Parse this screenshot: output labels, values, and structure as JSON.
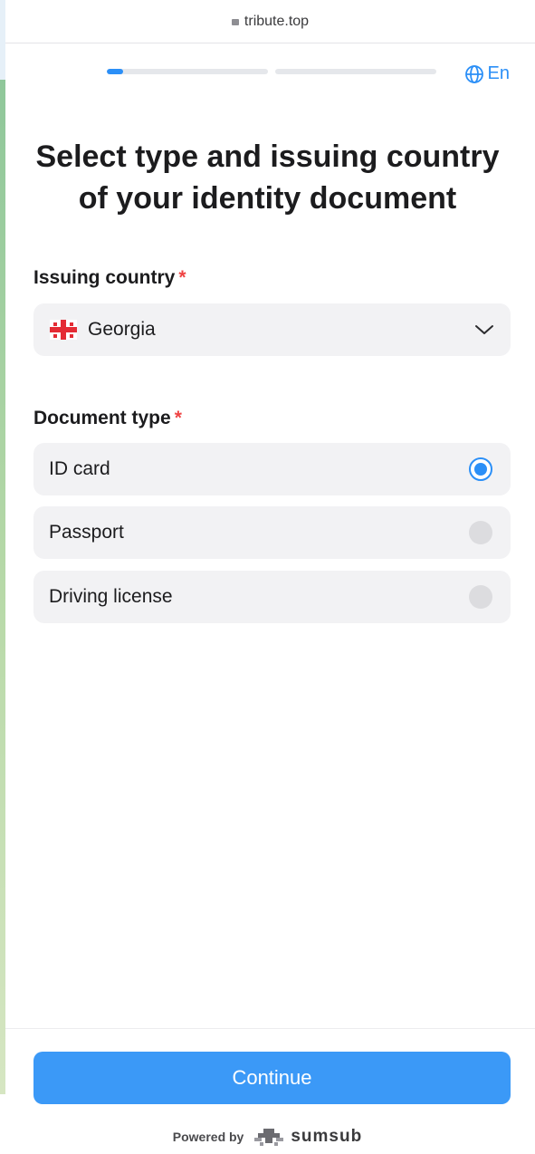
{
  "browser": {
    "url": "tribute.top"
  },
  "progress": {
    "steps": 2,
    "current_fill": 0.1
  },
  "language": {
    "label": "En"
  },
  "title": {
    "line1": "Select type and issuing country",
    "line2": "of your identity document"
  },
  "country": {
    "label": "Issuing country",
    "required_mark": "*",
    "value": "Georgia",
    "flag_icon": "georgia-flag-icon"
  },
  "document_type": {
    "label": "Document type",
    "required_mark": "*",
    "options": [
      {
        "label": "ID card",
        "selected": true
      },
      {
        "label": "Passport",
        "selected": false
      },
      {
        "label": "Driving license",
        "selected": false
      }
    ]
  },
  "footer": {
    "continue_label": "Continue",
    "powered_by": "Powered by",
    "brand": "sumsub"
  },
  "colors": {
    "accent": "#2b8ff7",
    "button": "#3b99f7",
    "required": "#ef4444"
  }
}
